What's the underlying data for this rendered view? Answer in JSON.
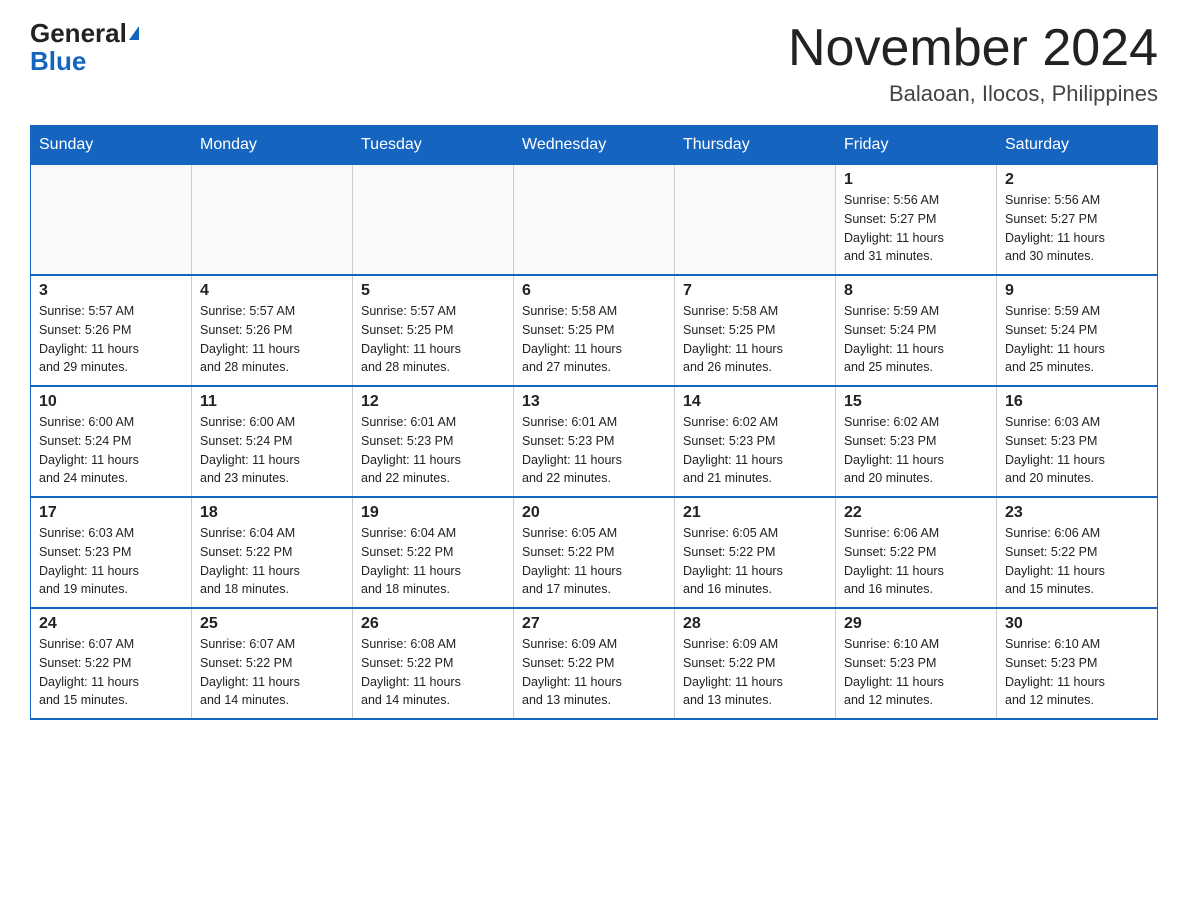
{
  "header": {
    "logo_general": "General",
    "logo_blue": "Blue",
    "month_title": "November 2024",
    "location": "Balaoan, Ilocos, Philippines"
  },
  "weekdays": [
    "Sunday",
    "Monday",
    "Tuesday",
    "Wednesday",
    "Thursday",
    "Friday",
    "Saturday"
  ],
  "weeks": [
    [
      {
        "day": "",
        "info": ""
      },
      {
        "day": "",
        "info": ""
      },
      {
        "day": "",
        "info": ""
      },
      {
        "day": "",
        "info": ""
      },
      {
        "day": "",
        "info": ""
      },
      {
        "day": "1",
        "info": "Sunrise: 5:56 AM\nSunset: 5:27 PM\nDaylight: 11 hours\nand 31 minutes."
      },
      {
        "day": "2",
        "info": "Sunrise: 5:56 AM\nSunset: 5:27 PM\nDaylight: 11 hours\nand 30 minutes."
      }
    ],
    [
      {
        "day": "3",
        "info": "Sunrise: 5:57 AM\nSunset: 5:26 PM\nDaylight: 11 hours\nand 29 minutes."
      },
      {
        "day": "4",
        "info": "Sunrise: 5:57 AM\nSunset: 5:26 PM\nDaylight: 11 hours\nand 28 minutes."
      },
      {
        "day": "5",
        "info": "Sunrise: 5:57 AM\nSunset: 5:25 PM\nDaylight: 11 hours\nand 28 minutes."
      },
      {
        "day": "6",
        "info": "Sunrise: 5:58 AM\nSunset: 5:25 PM\nDaylight: 11 hours\nand 27 minutes."
      },
      {
        "day": "7",
        "info": "Sunrise: 5:58 AM\nSunset: 5:25 PM\nDaylight: 11 hours\nand 26 minutes."
      },
      {
        "day": "8",
        "info": "Sunrise: 5:59 AM\nSunset: 5:24 PM\nDaylight: 11 hours\nand 25 minutes."
      },
      {
        "day": "9",
        "info": "Sunrise: 5:59 AM\nSunset: 5:24 PM\nDaylight: 11 hours\nand 25 minutes."
      }
    ],
    [
      {
        "day": "10",
        "info": "Sunrise: 6:00 AM\nSunset: 5:24 PM\nDaylight: 11 hours\nand 24 minutes."
      },
      {
        "day": "11",
        "info": "Sunrise: 6:00 AM\nSunset: 5:24 PM\nDaylight: 11 hours\nand 23 minutes."
      },
      {
        "day": "12",
        "info": "Sunrise: 6:01 AM\nSunset: 5:23 PM\nDaylight: 11 hours\nand 22 minutes."
      },
      {
        "day": "13",
        "info": "Sunrise: 6:01 AM\nSunset: 5:23 PM\nDaylight: 11 hours\nand 22 minutes."
      },
      {
        "day": "14",
        "info": "Sunrise: 6:02 AM\nSunset: 5:23 PM\nDaylight: 11 hours\nand 21 minutes."
      },
      {
        "day": "15",
        "info": "Sunrise: 6:02 AM\nSunset: 5:23 PM\nDaylight: 11 hours\nand 20 minutes."
      },
      {
        "day": "16",
        "info": "Sunrise: 6:03 AM\nSunset: 5:23 PM\nDaylight: 11 hours\nand 20 minutes."
      }
    ],
    [
      {
        "day": "17",
        "info": "Sunrise: 6:03 AM\nSunset: 5:23 PM\nDaylight: 11 hours\nand 19 minutes."
      },
      {
        "day": "18",
        "info": "Sunrise: 6:04 AM\nSunset: 5:22 PM\nDaylight: 11 hours\nand 18 minutes."
      },
      {
        "day": "19",
        "info": "Sunrise: 6:04 AM\nSunset: 5:22 PM\nDaylight: 11 hours\nand 18 minutes."
      },
      {
        "day": "20",
        "info": "Sunrise: 6:05 AM\nSunset: 5:22 PM\nDaylight: 11 hours\nand 17 minutes."
      },
      {
        "day": "21",
        "info": "Sunrise: 6:05 AM\nSunset: 5:22 PM\nDaylight: 11 hours\nand 16 minutes."
      },
      {
        "day": "22",
        "info": "Sunrise: 6:06 AM\nSunset: 5:22 PM\nDaylight: 11 hours\nand 16 minutes."
      },
      {
        "day": "23",
        "info": "Sunrise: 6:06 AM\nSunset: 5:22 PM\nDaylight: 11 hours\nand 15 minutes."
      }
    ],
    [
      {
        "day": "24",
        "info": "Sunrise: 6:07 AM\nSunset: 5:22 PM\nDaylight: 11 hours\nand 15 minutes."
      },
      {
        "day": "25",
        "info": "Sunrise: 6:07 AM\nSunset: 5:22 PM\nDaylight: 11 hours\nand 14 minutes."
      },
      {
        "day": "26",
        "info": "Sunrise: 6:08 AM\nSunset: 5:22 PM\nDaylight: 11 hours\nand 14 minutes."
      },
      {
        "day": "27",
        "info": "Sunrise: 6:09 AM\nSunset: 5:22 PM\nDaylight: 11 hours\nand 13 minutes."
      },
      {
        "day": "28",
        "info": "Sunrise: 6:09 AM\nSunset: 5:22 PM\nDaylight: 11 hours\nand 13 minutes."
      },
      {
        "day": "29",
        "info": "Sunrise: 6:10 AM\nSunset: 5:23 PM\nDaylight: 11 hours\nand 12 minutes."
      },
      {
        "day": "30",
        "info": "Sunrise: 6:10 AM\nSunset: 5:23 PM\nDaylight: 11 hours\nand 12 minutes."
      }
    ]
  ]
}
